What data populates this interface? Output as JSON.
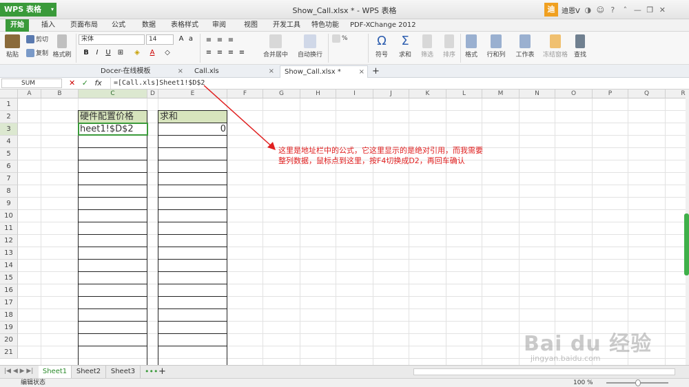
{
  "app": {
    "name": "WPS 表格",
    "window_title": "Show_Call.xlsx * - WPS 表格",
    "user_initial": "迪",
    "user_name": "迪恩V"
  },
  "menu_tabs": [
    "开始",
    "插入",
    "页面布局",
    "公式",
    "数据",
    "表格样式",
    "审阅",
    "视图",
    "开发工具",
    "特色功能",
    "PDF-XChange 2012"
  ],
  "ribbon": {
    "paste": "粘贴",
    "cut": "剪切",
    "copy": "复制",
    "format_painter": "格式刷",
    "font_name": "宋体",
    "font_size": "14",
    "merge": "合并居中",
    "wrap": "自动换行",
    "number_format": "%",
    "symbol": "符号",
    "sum": "求和",
    "filter": "筛选",
    "sort": "排序",
    "format": "格式",
    "row_col": "行和列",
    "worksheet": "工作表",
    "freeze": "冻结窗格",
    "find": "查找"
  },
  "doc_tabs": [
    "Docer-在线模板",
    "Call.xls",
    "Show_Call.xlsx *"
  ],
  "formula_bar": {
    "name_box": "SUM",
    "fx": "fx",
    "formula": "=[Call.xls]Sheet1!$D$2"
  },
  "columns": [
    "A",
    "B",
    "C",
    "D",
    "E",
    "F",
    "G",
    "H",
    "I",
    "J",
    "K",
    "L",
    "M",
    "N",
    "O",
    "P",
    "Q",
    "R"
  ],
  "rows": [
    "1",
    "2",
    "3",
    "4",
    "5",
    "6",
    "7",
    "8",
    "9",
    "10",
    "11",
    "12",
    "13",
    "14",
    "15",
    "16",
    "17",
    "18",
    "19",
    "20",
    "21"
  ],
  "cells": {
    "c2": "硬件配置价格",
    "e2": "求和",
    "c3": "heet1!$D$2",
    "e3": "0"
  },
  "annotation": "这里是地址栏中的公式，它这里显示的是绝对引用，而我需要整列数据，鼠标点到这里，按F4切换成D2，再回车确认",
  "sheets": [
    "Sheet1",
    "Sheet2",
    "Sheet3"
  ],
  "status": {
    "mode": "编辑状态",
    "zoom": "100 %"
  },
  "watermark": {
    "logo": "Bai du 经验",
    "url": "jingyan.baidu.com"
  },
  "colors": {
    "accent": "#3a9a3a",
    "annotation": "#e02020"
  }
}
